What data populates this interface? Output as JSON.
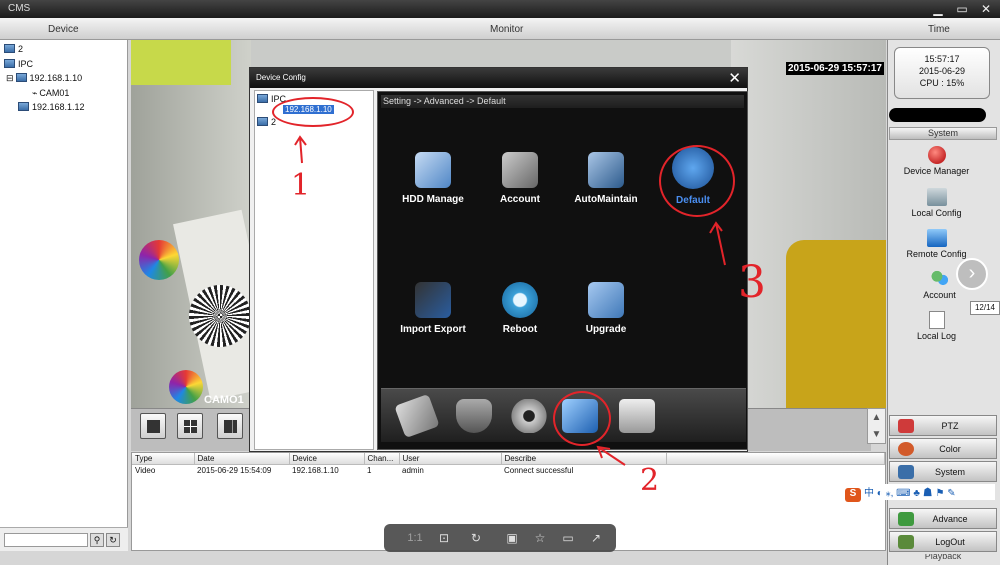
{
  "window": {
    "title": "CMS"
  },
  "columns": {
    "device": "Device",
    "monitor": "Monitor",
    "time": "Time"
  },
  "device_tree": [
    {
      "label": "2"
    },
    {
      "label": "IPC"
    },
    {
      "label": "192.168.1.10"
    },
    {
      "label": "CAM01"
    },
    {
      "label": "192.168.1.12"
    }
  ],
  "video": {
    "timestamp_overlay": "2015-06-29 15:57:17",
    "camera_label": "CAMO1"
  },
  "clock": {
    "time": "15:57:17",
    "date": "2015-06-29",
    "cpu": "CPU : 15%"
  },
  "system_panel": {
    "header": "System",
    "items": [
      {
        "label": "Device Manager",
        "icon": "red-button-icon"
      },
      {
        "label": "Local Config",
        "icon": "local-config-icon"
      },
      {
        "label": "Remote Config",
        "icon": "remote-config-icon"
      },
      {
        "label": "Account",
        "icon": "users-icon"
      },
      {
        "label": "Local Log",
        "icon": "document-icon"
      }
    ],
    "pager": "12/14"
  },
  "bottom_tabs": [
    {
      "label": "PTZ",
      "color": "#cf3a3a"
    },
    {
      "label": "Color",
      "color": "#d25a2a"
    },
    {
      "label": "System",
      "color": "#3a6ea8"
    },
    {
      "label": "Advance",
      "color": "#3f9a3f"
    },
    {
      "label": "LogOut",
      "color": "#5a8a3a"
    }
  ],
  "bottom_tab_cut_text": "Playback",
  "ime_bar": {
    "char": "中"
  },
  "log": {
    "headers": [
      "Type",
      "Date",
      "Device",
      "Chan...",
      "User",
      "Describe"
    ],
    "rows": [
      [
        "Video",
        "2015-06-29 15:54:09",
        "192.168.1.10",
        "1",
        "admin",
        "Connect successful"
      ]
    ]
  },
  "dialog": {
    "title": "Device Config",
    "close": "✕",
    "tree": {
      "root": "IPC",
      "selected": "192.168.1.10",
      "second": "2"
    },
    "breadcrumb": "Setting -> Advanced -> Default",
    "items": [
      {
        "label": "HDD Manage",
        "color": "#4f86c6"
      },
      {
        "label": "Account",
        "color": "#8a8a8a"
      },
      {
        "label": "AutoMaintain",
        "color": "#5a7ea8"
      },
      {
        "label": "Default",
        "color": "#2f6fb8"
      },
      {
        "label": "Import Export",
        "color": "#2a5da0"
      },
      {
        "label": "Reboot",
        "color": "#3aa0d8"
      },
      {
        "label": "Upgrade",
        "color": "#3f78b8"
      }
    ],
    "tools": [
      "hdd-tool-icon",
      "alarm-shield-icon",
      "gear-icon",
      "advanced-icon",
      "info-list-icon"
    ]
  },
  "annotations": {
    "n1": "1",
    "n2": "2",
    "n3": "3"
  },
  "playback_bar": {
    "zoom_label": "1:1"
  }
}
